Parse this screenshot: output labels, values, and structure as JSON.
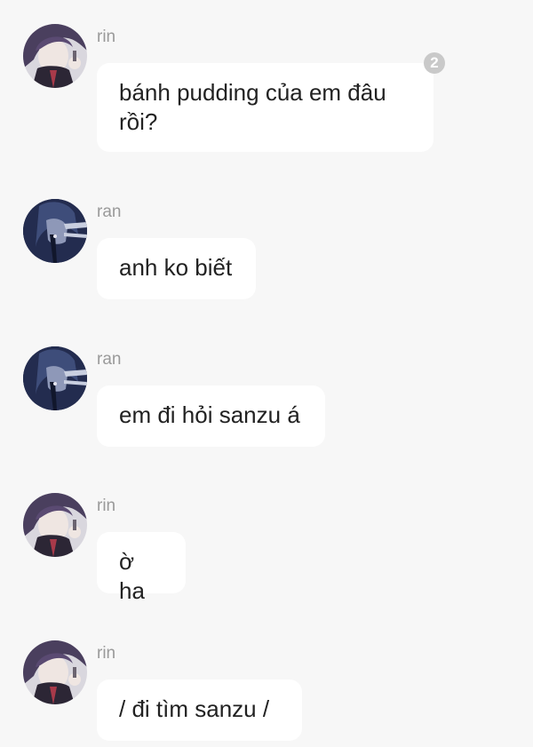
{
  "messages": [
    {
      "sender": "rin",
      "text": "bánh pudding của em đâu rồi?",
      "read_count": "2",
      "avatar_icon": "rin-avatar"
    },
    {
      "sender": "ran",
      "text": "anh ko biết",
      "avatar_icon": "ran-avatar"
    },
    {
      "sender": "ran",
      "text": "em đi hỏi sanzu á",
      "avatar_icon": "ran-avatar"
    },
    {
      "sender": "rin",
      "text": "ờ ha",
      "avatar_icon": "rin-avatar"
    },
    {
      "sender": "rin",
      "text": "/ đi tìm sanzu /",
      "avatar_icon": "rin-avatar"
    }
  ],
  "colors": {
    "background": "#f7f7f7",
    "bubble": "#ffffff",
    "sender_name": "#9a9a9a",
    "badge": "#c9c9c9"
  }
}
